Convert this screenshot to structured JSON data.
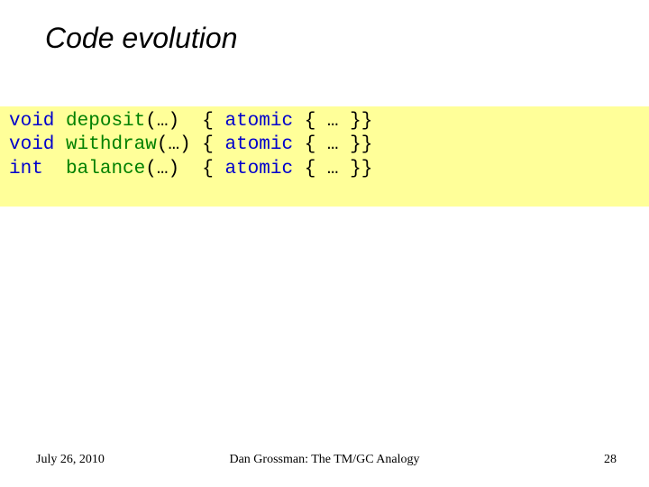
{
  "title": "Code evolution",
  "code": {
    "line1": {
      "kw": "void",
      "sp1": " ",
      "fn": "deposit",
      "tail": "(…)  { ",
      "kw2": "atomic",
      "tail2": " { … }}"
    },
    "line2": {
      "kw": "void",
      "sp1": " ",
      "fn": "withdraw",
      "tail": "(…) { ",
      "kw2": "atomic",
      "tail2": " { … }}"
    },
    "line3": {
      "kw": "int",
      "sp1": "  ",
      "fn": "balance",
      "tail": "(…)  { ",
      "kw2": "atomic",
      "tail2": " { … }}"
    }
  },
  "footer": {
    "date": "July 26, 2010",
    "center": "Dan Grossman: The TM/GC Analogy",
    "page": "28"
  }
}
